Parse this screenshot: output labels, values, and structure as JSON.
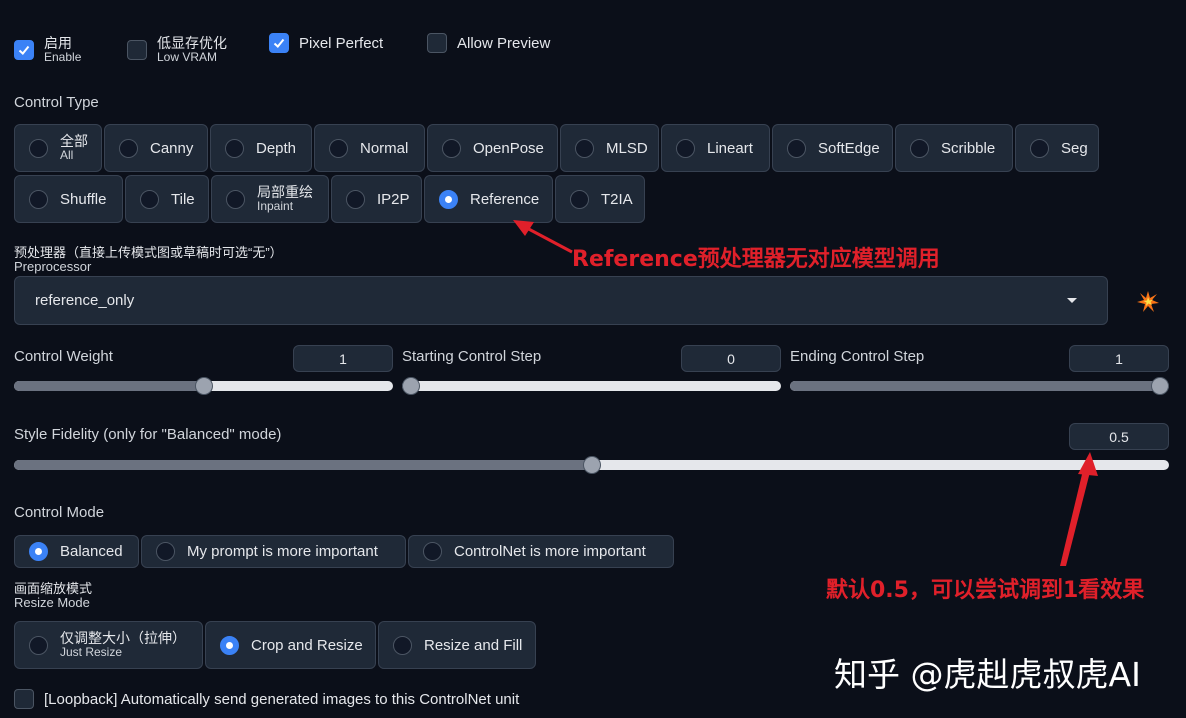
{
  "top_checks": [
    {
      "zh": "启用",
      "en": "Enable",
      "checked": true
    },
    {
      "zh": "低显存优化",
      "en": "Low VRAM",
      "checked": false
    },
    {
      "label": "Pixel Perfect",
      "checked": true
    },
    {
      "label": "Allow Preview",
      "checked": false
    }
  ],
  "control_type": {
    "label": "Control Type",
    "row1": [
      {
        "zh": "全部",
        "en": "All"
      },
      {
        "label": "Canny"
      },
      {
        "label": "Depth"
      },
      {
        "label": "Normal"
      },
      {
        "label": "OpenPose"
      },
      {
        "label": "MLSD"
      },
      {
        "label": "Lineart"
      },
      {
        "label": "SoftEdge"
      },
      {
        "label": "Scribble"
      },
      {
        "label": "Seg"
      }
    ],
    "row2": [
      {
        "label": "Shuffle"
      },
      {
        "label": "Tile"
      },
      {
        "zh": "局部重绘",
        "en": "Inpaint"
      },
      {
        "label": "IP2P"
      },
      {
        "label": "Reference",
        "selected": true
      },
      {
        "label": "T2IA"
      }
    ]
  },
  "preprocessor": {
    "label_zh": "预处理器（直接上传模式图或草稿时可选“无”）",
    "label_en": "Preprocessor",
    "value": "reference_only",
    "icon": "explosion-icon"
  },
  "sliders": {
    "control_weight": {
      "label": "Control Weight",
      "value": "1",
      "fraction": 0.5
    },
    "starting_step": {
      "label": "Starting Control Step",
      "value": "0",
      "fraction": 0.0
    },
    "ending_step": {
      "label": "Ending Control Step",
      "value": "1",
      "fraction": 1.0
    },
    "style_fidelity": {
      "label": "Style Fidelity (only for \"Balanced\" mode)",
      "value": "0.5",
      "fraction": 0.5
    }
  },
  "control_mode": {
    "label": "Control Mode",
    "options": [
      {
        "label": "Balanced",
        "selected": true
      },
      {
        "label": "My prompt is more important"
      },
      {
        "label": "ControlNet is more important"
      }
    ]
  },
  "resize_mode": {
    "label_zh": "画面缩放模式",
    "label_en": "Resize Mode",
    "options": [
      {
        "zh": "仅调整大小（拉伸）",
        "en": "Just Resize"
      },
      {
        "label": "Crop and Resize",
        "selected": true
      },
      {
        "label": "Resize and Fill"
      }
    ]
  },
  "loopback": {
    "label": "[Loopback] Automatically send generated images to this ControlNet unit",
    "checked": false
  },
  "annotations": {
    "reference_note": "Reference预处理器无对应模型调用",
    "fidelity_note": "默认0.5，可以尝试调到1看效果",
    "watermark": "知乎 @虎赳虎叔虎AI",
    "color": "#e0202a"
  },
  "colors": {
    "accent": "#3b82f6",
    "background": "#0b0f19",
    "panel": "#1f2937"
  }
}
